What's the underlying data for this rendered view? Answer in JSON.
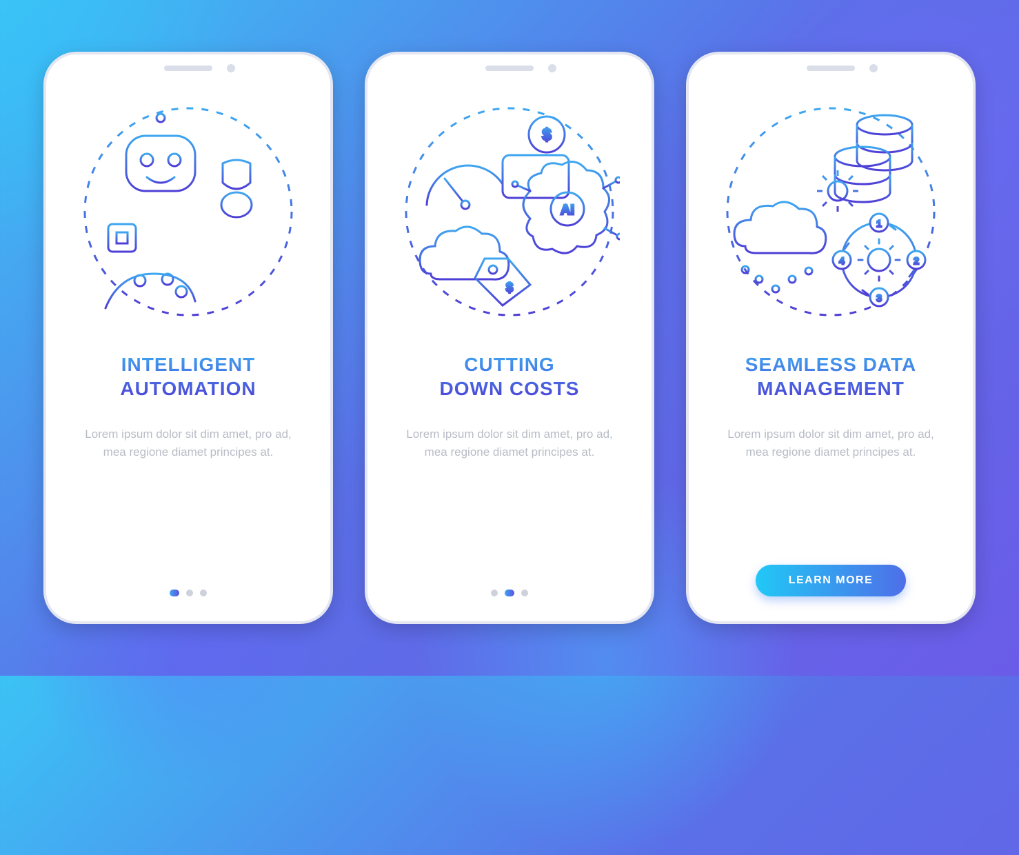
{
  "colors": {
    "stroke_light": "#3EA7F0",
    "stroke_dark": "#4E3FD6",
    "dot_inactive": "#CDD1DB"
  },
  "screens": [
    {
      "icon": "automation",
      "title": "INTELLIGENT\nAUTOMATION",
      "body": "Lorem ipsum dolor sit dim amet, pro ad, mea regione diamet principes at.",
      "ctrl": "dots",
      "active_dot": 0
    },
    {
      "icon": "costs",
      "title": "CUTTING\nDOWN COSTS",
      "body": "Lorem ipsum dolor sit dim amet, pro ad, mea regione diamet principes at.",
      "ctrl": "dots",
      "active_dot": 1
    },
    {
      "icon": "data-management",
      "title": "SEAMLESS DATA\nMANAGEMENT",
      "body": "Lorem ipsum dolor sit dim amet, pro ad, mea regione diamet principes at.",
      "ctrl": "button",
      "cta_label": "LEARN MORE"
    }
  ]
}
